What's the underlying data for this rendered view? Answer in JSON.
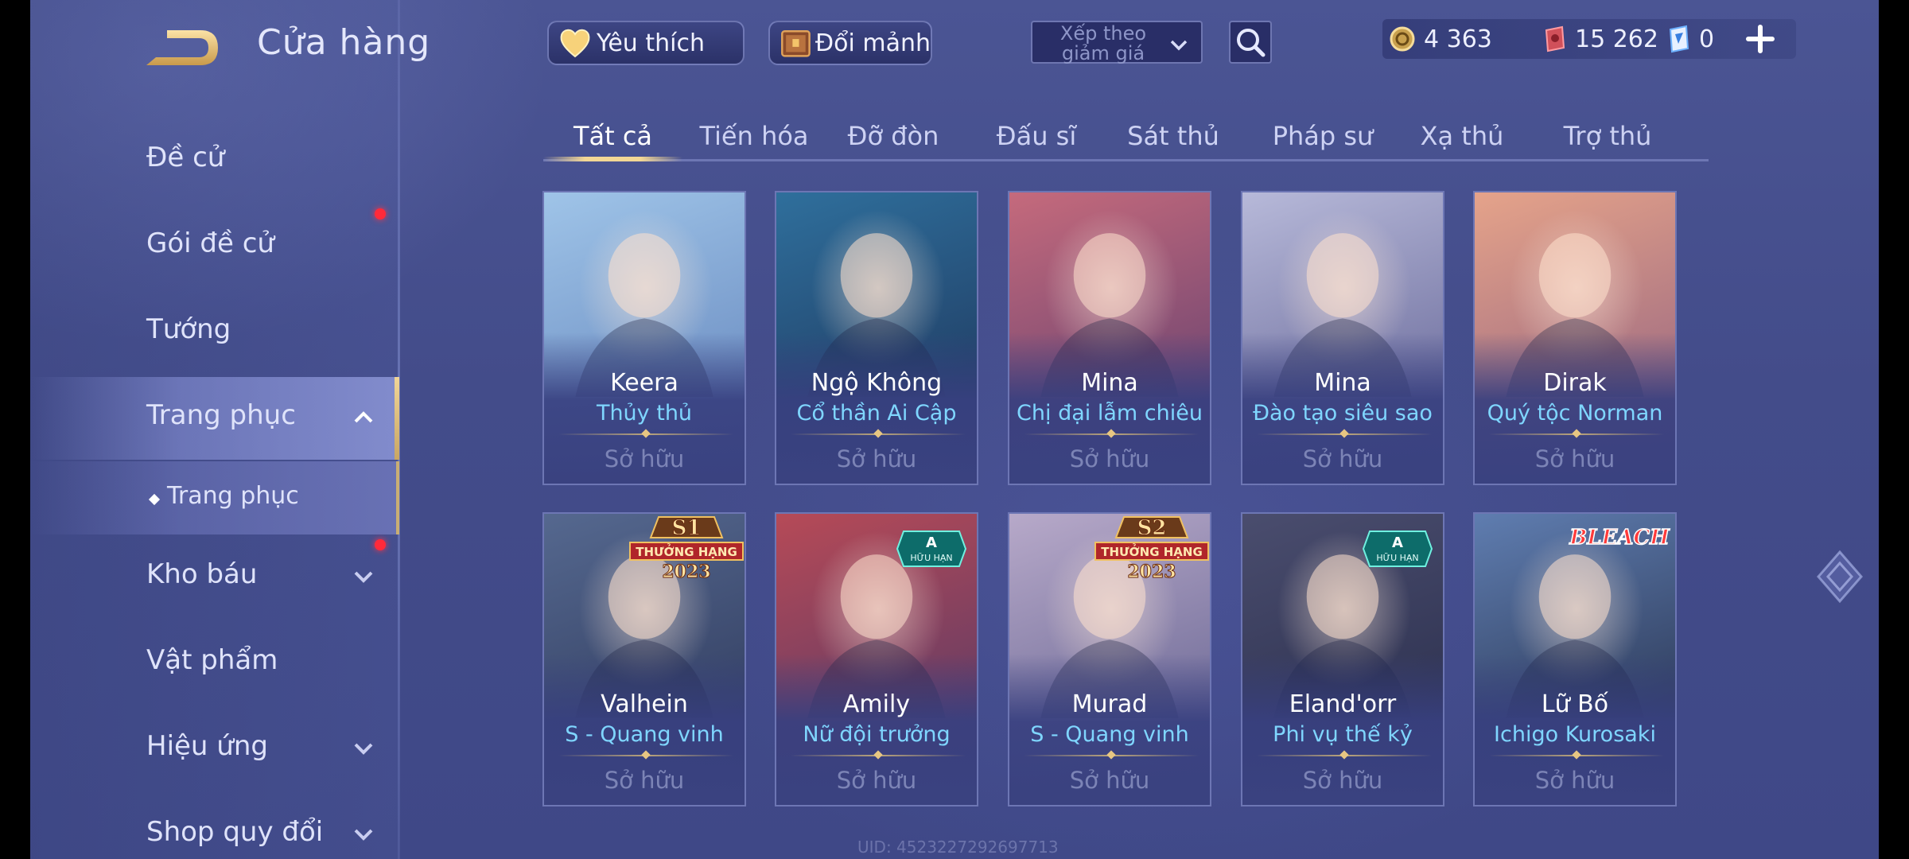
{
  "header": {
    "title": "Cửa hàng",
    "favorite_label": "Yêu thích",
    "exchange_label": "Đổi mảnh",
    "sort_label": "Xếp theo giảm giá",
    "currencies": [
      {
        "name": "gold-coin",
        "value": "4 363"
      },
      {
        "name": "ruby-voucher",
        "value": "15 262"
      },
      {
        "name": "blue-card",
        "value": "0"
      }
    ]
  },
  "sidebar": {
    "items": [
      {
        "label": "Đề cử"
      },
      {
        "label": "Gói đề cử"
      },
      {
        "label": "Tướng"
      },
      {
        "label": "Trang phục"
      },
      {
        "label": "Trang phục"
      },
      {
        "label": "Kho báu"
      },
      {
        "label": "Vật phẩm"
      },
      {
        "label": "Hiệu ứng"
      },
      {
        "label": "Shop quy đổi"
      }
    ]
  },
  "tabs": [
    {
      "label": "Tất cả"
    },
    {
      "label": "Tiến hóa"
    },
    {
      "label": "Đỡ đòn"
    },
    {
      "label": "Đấu sĩ"
    },
    {
      "label": "Sát thủ"
    },
    {
      "label": "Pháp sư"
    },
    {
      "label": "Xạ thủ"
    },
    {
      "label": "Trợ thủ"
    }
  ],
  "cards": [
    {
      "hero": "Keera",
      "skin": "Thủy thủ",
      "status": "Sở hữu",
      "colors": [
        "#9fc4e8",
        "#5e7fb8"
      ]
    },
    {
      "hero": "Ngộ Không",
      "skin": "Cổ thần Ai Cập",
      "status": "Sở hữu",
      "colors": [
        "#2f6f9c",
        "#1c2f54"
      ]
    },
    {
      "hero": "Mina",
      "skin": "Chị đại lẫm chiêu",
      "status": "Sở hữu",
      "colors": [
        "#c56a7c",
        "#553a6e"
      ]
    },
    {
      "hero": "Mina",
      "skin": "Đào tạo siêu sao",
      "status": "Sở hữu",
      "colors": [
        "#b7b9d9",
        "#5a5a8e"
      ]
    },
    {
      "hero": "Dirak",
      "skin": "Quý tộc Norman",
      "status": "Sở hữu",
      "colors": [
        "#e5a38a",
        "#8a5a7e"
      ]
    },
    {
      "hero": "Valhein",
      "skin": "S - Quang vinh",
      "status": "Sở hữu",
      "colors": [
        "#55688f",
        "#2a3456"
      ],
      "badge": {
        "type": "season",
        "top": "S1",
        "mid": "THƯỞNG HẠNG",
        "bot": "2023"
      }
    },
    {
      "hero": "Amily",
      "skin": "Nữ đội trưởng",
      "status": "Sở hữu",
      "colors": [
        "#b64a57",
        "#4b3768"
      ],
      "badge": {
        "type": "limited",
        "top": "A",
        "mid": "HỮU HẠN"
      }
    },
    {
      "hero": "Murad",
      "skin": "S - Quang vinh",
      "status": "Sở hữu",
      "colors": [
        "#b7a9c9",
        "#5b5a8a"
      ],
      "badge": {
        "type": "season",
        "top": "S2",
        "mid": "THƯỞNG HẠNG",
        "bot": "2023"
      }
    },
    {
      "hero": "Eland'orr",
      "skin": "Phi vụ thế kỷ",
      "status": "Sở hữu",
      "colors": [
        "#4a4d6e",
        "#262a48"
      ],
      "badge": {
        "type": "limited",
        "top": "A",
        "mid": "HỮU HẠN"
      }
    },
    {
      "hero": "Lữ Bố",
      "skin": "Ichigo Kurosaki",
      "status": "Sở hữu",
      "colors": [
        "#5f7db0",
        "#1f2740"
      ],
      "badge": {
        "type": "bleach",
        "top": "BLEACH"
      }
    }
  ],
  "footer": {
    "uid": "UID: 4523227292697713"
  }
}
